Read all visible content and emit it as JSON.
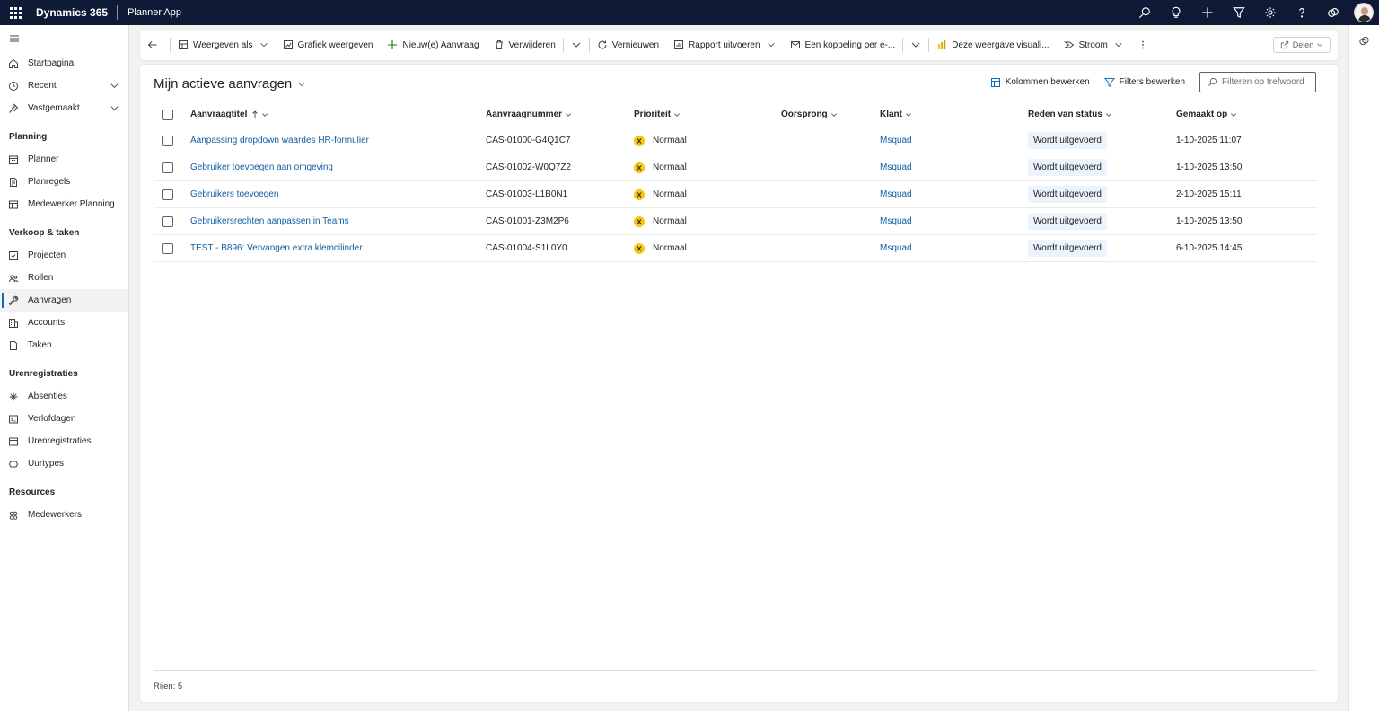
{
  "topbar": {
    "brand": "Dynamics 365",
    "app_name": "Planner App",
    "icons": [
      "search-icon",
      "lightbulb-icon",
      "plus-icon",
      "filter-icon",
      "gear-icon",
      "help-icon",
      "copilot-icon",
      "avatar"
    ]
  },
  "sidebar": {
    "top_items": [
      {
        "label": "Startpagina",
        "icon": "home-icon"
      },
      {
        "label": "Recent",
        "icon": "clock-icon"
      },
      {
        "label": "Vastgemaakt",
        "icon": "pin-icon"
      }
    ],
    "groups": [
      {
        "title": "Planning",
        "items": [
          {
            "label": "Planner",
            "icon": "calendar-icon"
          },
          {
            "label": "Planregels",
            "icon": "document-icon"
          },
          {
            "label": "Medewerker Planning",
            "icon": "table-icon"
          }
        ]
      },
      {
        "title": "Verkoop & taken",
        "items": [
          {
            "label": "Projecten",
            "icon": "project-icon"
          },
          {
            "label": "Rollen",
            "icon": "people-icon"
          },
          {
            "label": "Aanvragen",
            "icon": "wrench-icon"
          },
          {
            "label": "Accounts",
            "icon": "building-icon"
          },
          {
            "label": "Taken",
            "icon": "task-icon"
          }
        ]
      },
      {
        "title": "Urenregistraties",
        "items": [
          {
            "label": "Absenties",
            "icon": "absence-icon"
          },
          {
            "label": "Verlofdagen",
            "icon": "leave-icon"
          },
          {
            "label": "Urenregistraties",
            "icon": "timesheet-icon"
          },
          {
            "label": "Uurtypes",
            "icon": "hourtype-icon"
          }
        ]
      },
      {
        "title": "Resources",
        "items": [
          {
            "label": "Medewerkers",
            "icon": "employees-icon"
          }
        ]
      }
    ]
  },
  "commandbar": {
    "weergeven_als": "Weergeven als",
    "grafiek": "Grafiek weergeven",
    "nieuw": "Nieuw(e) Aanvraag",
    "verwijderen": "Verwijderen",
    "vernieuwen": "Vernieuwen",
    "rapport": "Rapport uitvoeren",
    "koppeling": "Een koppeling per e-...",
    "visual": "Deze weergave visuali...",
    "stroom": "Stroom",
    "delen": "Delen"
  },
  "view": {
    "title": "Mijn actieve aanvragen",
    "kolommen": "Kolommen bewerken",
    "filters": "Filters bewerken",
    "search_placeholder": "Filteren op trefwoord"
  },
  "grid": {
    "columns": [
      "Aanvraagtitel",
      "Aanvraagnummer",
      "Prioriteit",
      "Oorsprong",
      "Klant",
      "Reden van status",
      "Gemaakt op"
    ],
    "rows": [
      {
        "title": "Aanpassing dropdown waardes HR-formulier",
        "number": "CAS-01000-G4Q1C7",
        "priority": "Normaal",
        "origin": "",
        "customer": "Msquad",
        "status": "Wordt uitgevoerd",
        "created": "1-10-2025 11:07"
      },
      {
        "title": "Gebruiker toevoegen aan omgeving",
        "number": "CAS-01002-W0Q7Z2",
        "priority": "Normaal",
        "origin": "",
        "customer": "Msquad",
        "status": "Wordt uitgevoerd",
        "created": "1-10-2025 13:50"
      },
      {
        "title": "Gebruikers toevoegen",
        "number": "CAS-01003-L1B0N1",
        "priority": "Normaal",
        "origin": "",
        "customer": "Msquad",
        "status": "Wordt uitgevoerd",
        "created": "2-10-2025 15:11"
      },
      {
        "title": "Gebruikersrechten aanpassen in Teams",
        "number": "CAS-01001-Z3M2P6",
        "priority": "Normaal",
        "origin": "",
        "customer": "Msquad",
        "status": "Wordt uitgevoerd",
        "created": "1-10-2025 13:50"
      },
      {
        "title": "TEST - B896: Vervangen extra klemcilinder",
        "number": "CAS-01004-S1L0Y0",
        "priority": "Normaal",
        "origin": "",
        "customer": "Msquad",
        "status": "Wordt uitgevoerd",
        "created": "6-10-2025 14:45"
      }
    ],
    "rows_count": "Rijen: 5"
  },
  "colors": {
    "topbar": "#0e1a36",
    "link": "#115ea3",
    "accent": "#0f6cbd",
    "priority": "#f2c811",
    "badge": "#ebf3fc"
  }
}
